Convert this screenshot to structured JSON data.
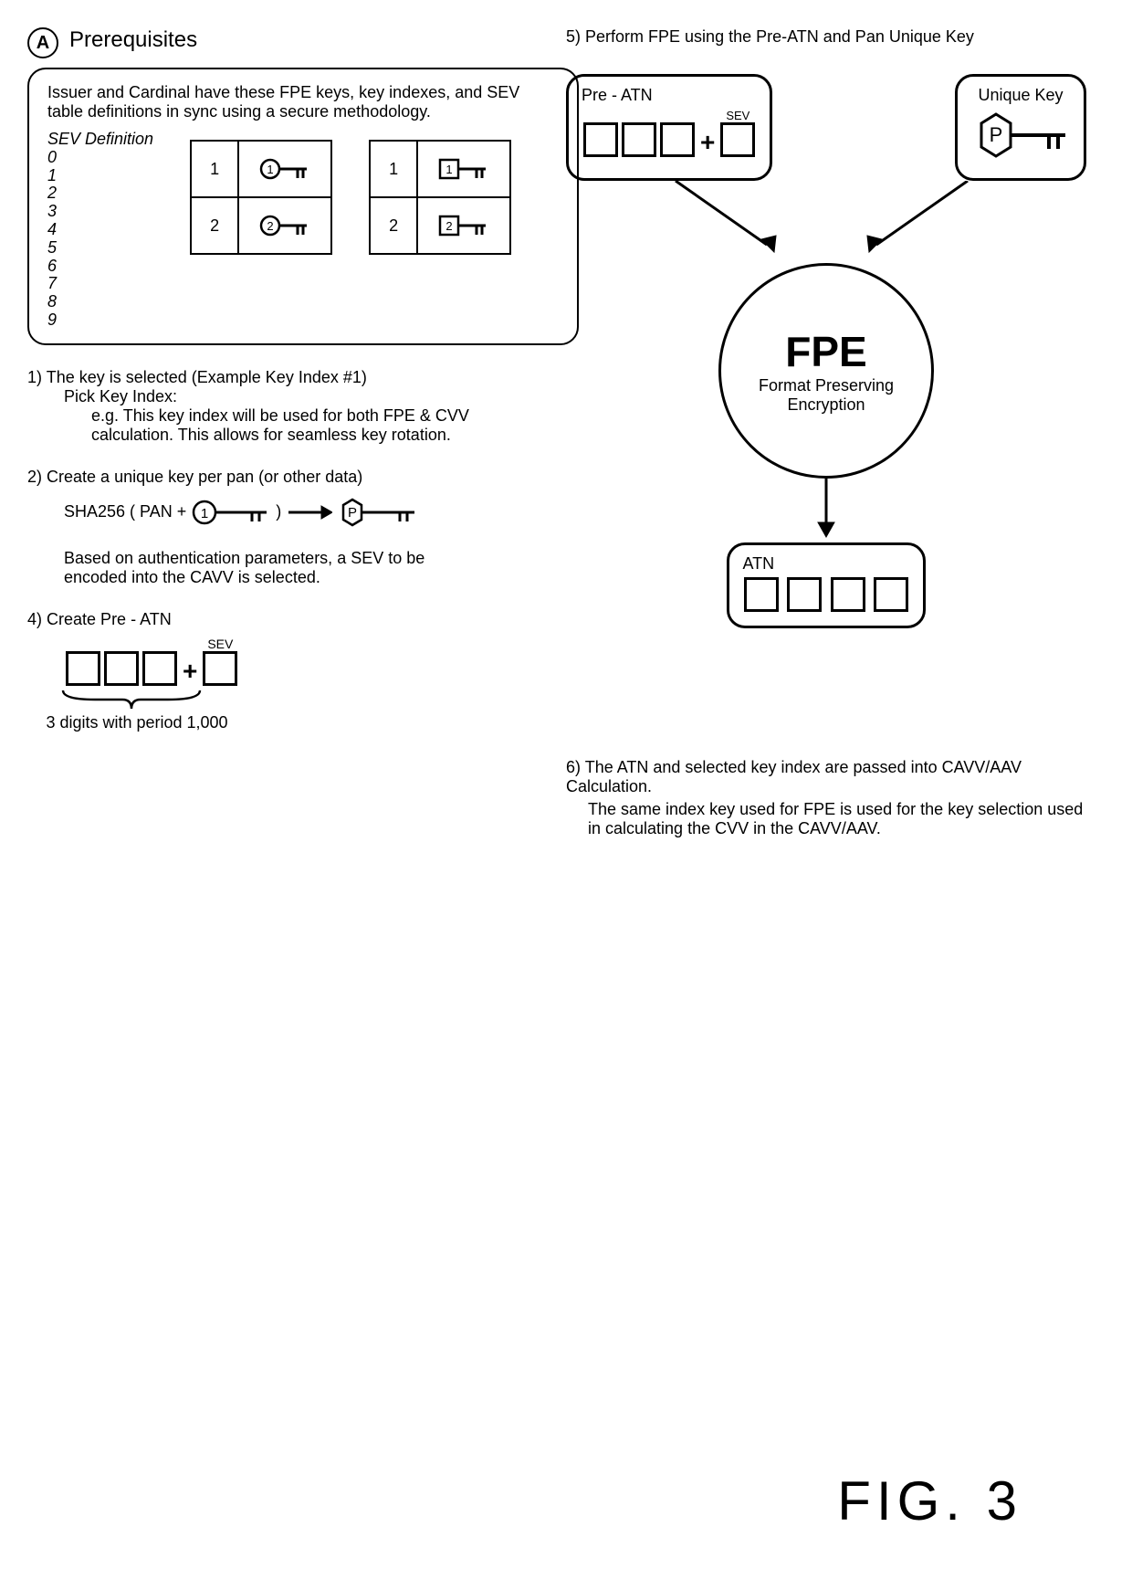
{
  "badge_a": "A",
  "prereq_title": "Prerequisites",
  "prereq_text": "Issuer and Cardinal have these FPE keys, key indexes, and SEV table definitions in sync using a secure methodology.",
  "sev_def_label": "SEV Definition",
  "sev_digits": [
    "0",
    "1",
    "2",
    "3",
    "4",
    "5",
    "6",
    "7",
    "8",
    "9"
  ],
  "key_indices": [
    "1",
    "2"
  ],
  "step1_num": "1)",
  "step1_line1": "The key is selected (Example Key Index #1)",
  "step1_line2": "Pick Key Index:",
  "step1_line3": "e.g. This key index will be used for both FPE & CVV calculation. This allows for seamless key rotation.",
  "step2_num": "2)",
  "step2_line1": "Create a unique key per pan (or other data)",
  "step2_sha_prefix": "SHA256 ( PAN +",
  "step2_sha_suffix": ")",
  "step2_para": "Based on authentication parameters, a SEV to be encoded into the CAVV is selected.",
  "step4_num": "4)",
  "step4_title": "Create Pre - ATN",
  "step4_sev": "SEV",
  "step4_note": "3 digits with period 1,000",
  "step5_num": "5)",
  "step5_text": "Perform FPE using the Pre-ATN and Pan Unique Key",
  "preatn_label": "Pre - ATN",
  "sev_label": "SEV",
  "unique_key_label": "Unique Key",
  "fpe_label": "FPE",
  "fpe_sub": "Format Preserving Encryption",
  "atn_label": "ATN",
  "step6_num": "6)",
  "step6_line1": "The ATN and selected key index are passed into CAVV/AAV Calculation.",
  "step6_line2": "The same index key used for FPE is used for the key selection used in calculating the CVV in the CAVV/AAV.",
  "key_p": "P",
  "key_1": "1",
  "fig": "FIG. 3"
}
